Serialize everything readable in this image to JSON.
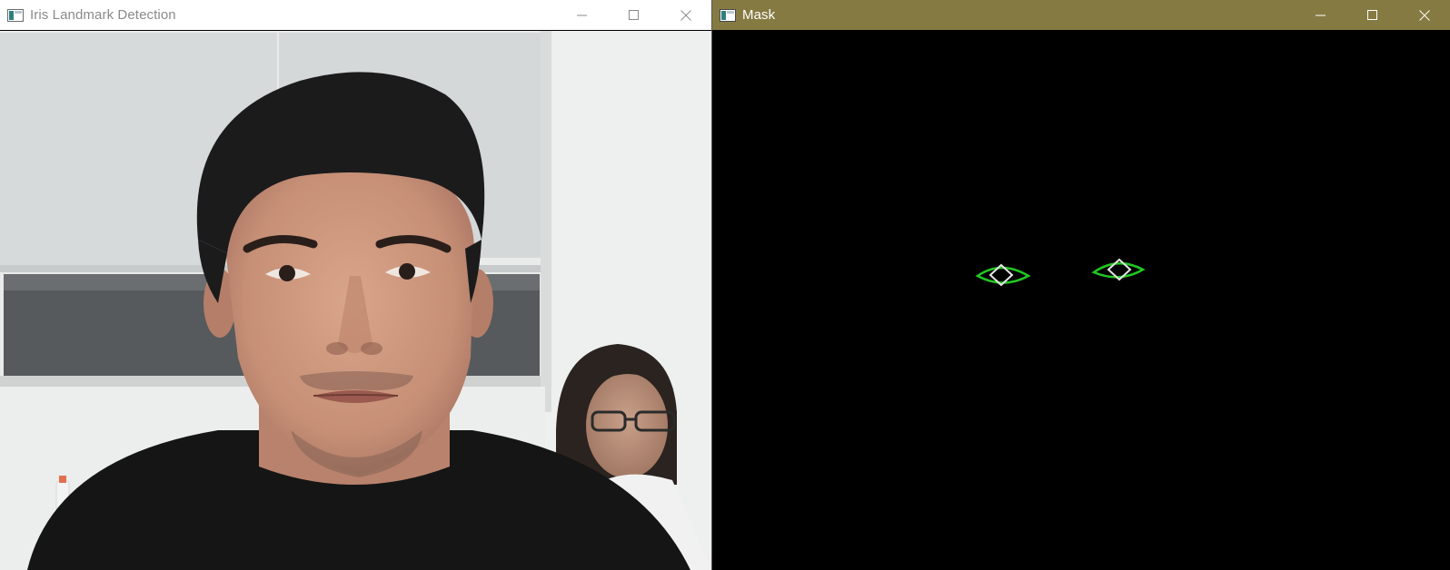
{
  "left_window": {
    "title": "Iris Landmark Detection",
    "icon": "opencv-window-icon",
    "controls": [
      "minimize-icon",
      "maximize-icon",
      "close-icon"
    ],
    "title_color": "#8a8a8a",
    "titlebar_color": "#ffffff"
  },
  "right_window": {
    "title": "Mask",
    "icon": "opencv-window-icon",
    "controls": [
      "minimize-icon",
      "maximize-icon",
      "close-icon"
    ],
    "title_color": "#ffffff",
    "titlebar_color": "#857a42",
    "mask_colors": {
      "eye_contour": "#22c722",
      "iris": "#e6e6e6",
      "background": "#000000"
    }
  }
}
